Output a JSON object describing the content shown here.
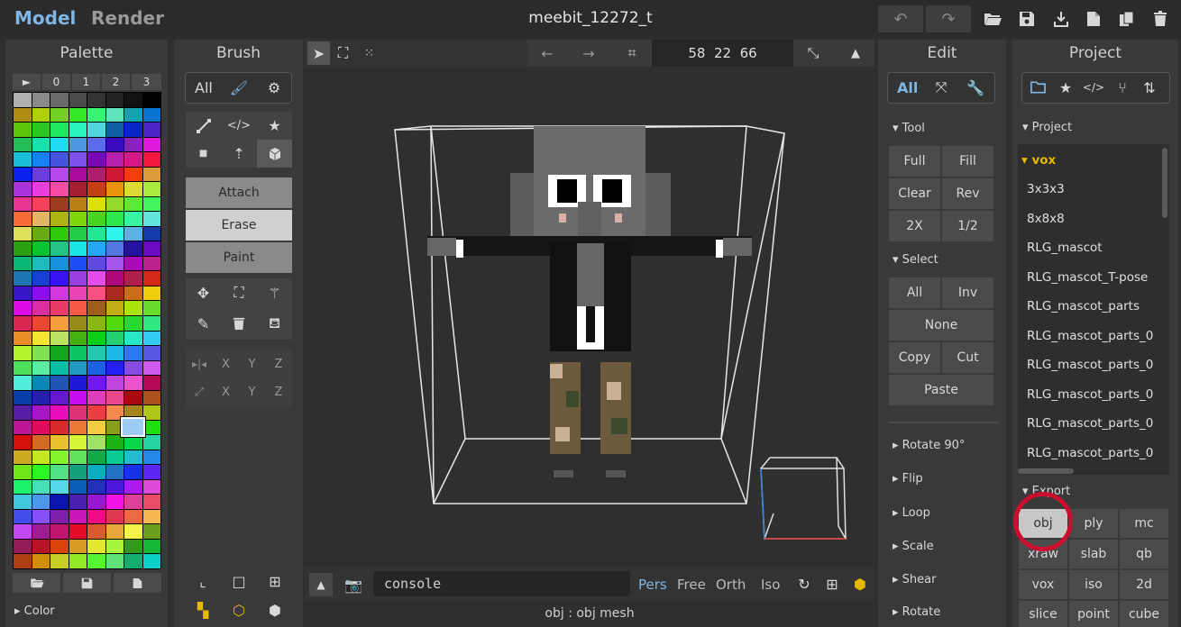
{
  "topbar": {
    "mode_model": "Model",
    "mode_render": "Render",
    "file_title": "meebit_12272_t"
  },
  "palette": {
    "title": "Palette",
    "tabs": [
      "►",
      "0",
      "1",
      "2",
      "3"
    ],
    "bottom_label": "Color"
  },
  "brush": {
    "title": "Brush",
    "filter_all": "All",
    "attach": "Attach",
    "erase": "Erase",
    "paint": "Paint",
    "axis_x": "X",
    "axis_y": "Y",
    "axis_z": "Z"
  },
  "viewport": {
    "coords": "58  22  66",
    "console_placeholder": "console",
    "views": [
      "Pers",
      "Free",
      "Orth",
      "Iso"
    ],
    "status": "obj : obj mesh"
  },
  "edit": {
    "title": "Edit",
    "filter_all": "All",
    "tool_section": "Tool",
    "tool_buttons": [
      "Full",
      "Fill",
      "Clear",
      "Rev",
      "2X",
      "1/2"
    ],
    "select_section": "Select",
    "select_all": "All",
    "select_inv": "Inv",
    "select_none": "None",
    "copy": "Copy",
    "cut": "Cut",
    "paste": "Paste",
    "sections": [
      "Rotate 90°",
      "Flip",
      "Loop",
      "Scale",
      "Shear",
      "Rotate"
    ]
  },
  "project": {
    "title": "Project",
    "section_project": "Project",
    "folder_open": "vox",
    "items": [
      "3x3x3",
      "8x8x8",
      "RLG_mascot",
      "RLG_mascot_T-pose",
      "RLG_mascot_parts",
      "RLG_mascot_parts_0",
      "RLG_mascot_parts_0",
      "RLG_mascot_parts_0",
      "RLG_mascot_parts_0",
      "RLG_mascot_parts_0"
    ],
    "section_export": "Export",
    "export_buttons": [
      "obj",
      "ply",
      "mc",
      "xraw",
      "slab",
      "qb",
      "vox",
      "iso",
      "2d",
      "slice",
      "point",
      "cube"
    ]
  },
  "colors": {
    "accent": "#7fb6e6",
    "highlight_ring": "#c8102e",
    "folder_yellow": "#e6b800"
  }
}
